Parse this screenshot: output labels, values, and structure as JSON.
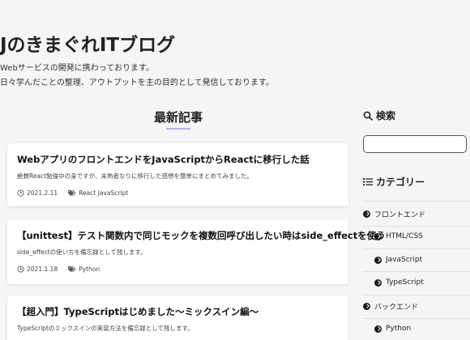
{
  "header": {
    "site_title": "JのきまぐれITブログ",
    "tagline_1": "Webサービスの開発に携わっております。",
    "tagline_2": "日々学んだことの整理、アウトプットを主の目的として発信しております。"
  },
  "main": {
    "section_title": "最新記事",
    "posts": [
      {
        "title": "WebアプリのフロントエンドをJavaScriptからReactに移行した話",
        "excerpt": "絶賛React勉強中の身ですが、未熟者なりに移行した感想を簡単にまとめてみました。",
        "date": "2021.2.11",
        "tags": "React JavaScript"
      },
      {
        "title": "【unittest】テスト関数内で同じモックを複数回呼び出したい時はside_effectを使う",
        "excerpt": "side_effectの使い方を備忘録として残します。",
        "date": "2021.1.18",
        "tags": "Python"
      },
      {
        "title": "【超入門】TypeScriptはじめました〜ミックスイン編〜",
        "excerpt": "TypeScriptのミックスインの実装方法を備忘録として残します。",
        "date": "",
        "tags": ""
      }
    ]
  },
  "sidebar": {
    "search_heading": "検索",
    "search_placeholder": "",
    "category_heading": "カテゴリー",
    "categories": [
      {
        "label": "フロントエンド",
        "level": 0
      },
      {
        "label": "HTML/CSS",
        "level": 1
      },
      {
        "label": "JavaScript",
        "level": 1
      },
      {
        "label": "TypeScript",
        "level": 1
      },
      {
        "label": "バックエンド",
        "level": 0
      },
      {
        "label": "Python",
        "level": 1
      }
    ]
  }
}
